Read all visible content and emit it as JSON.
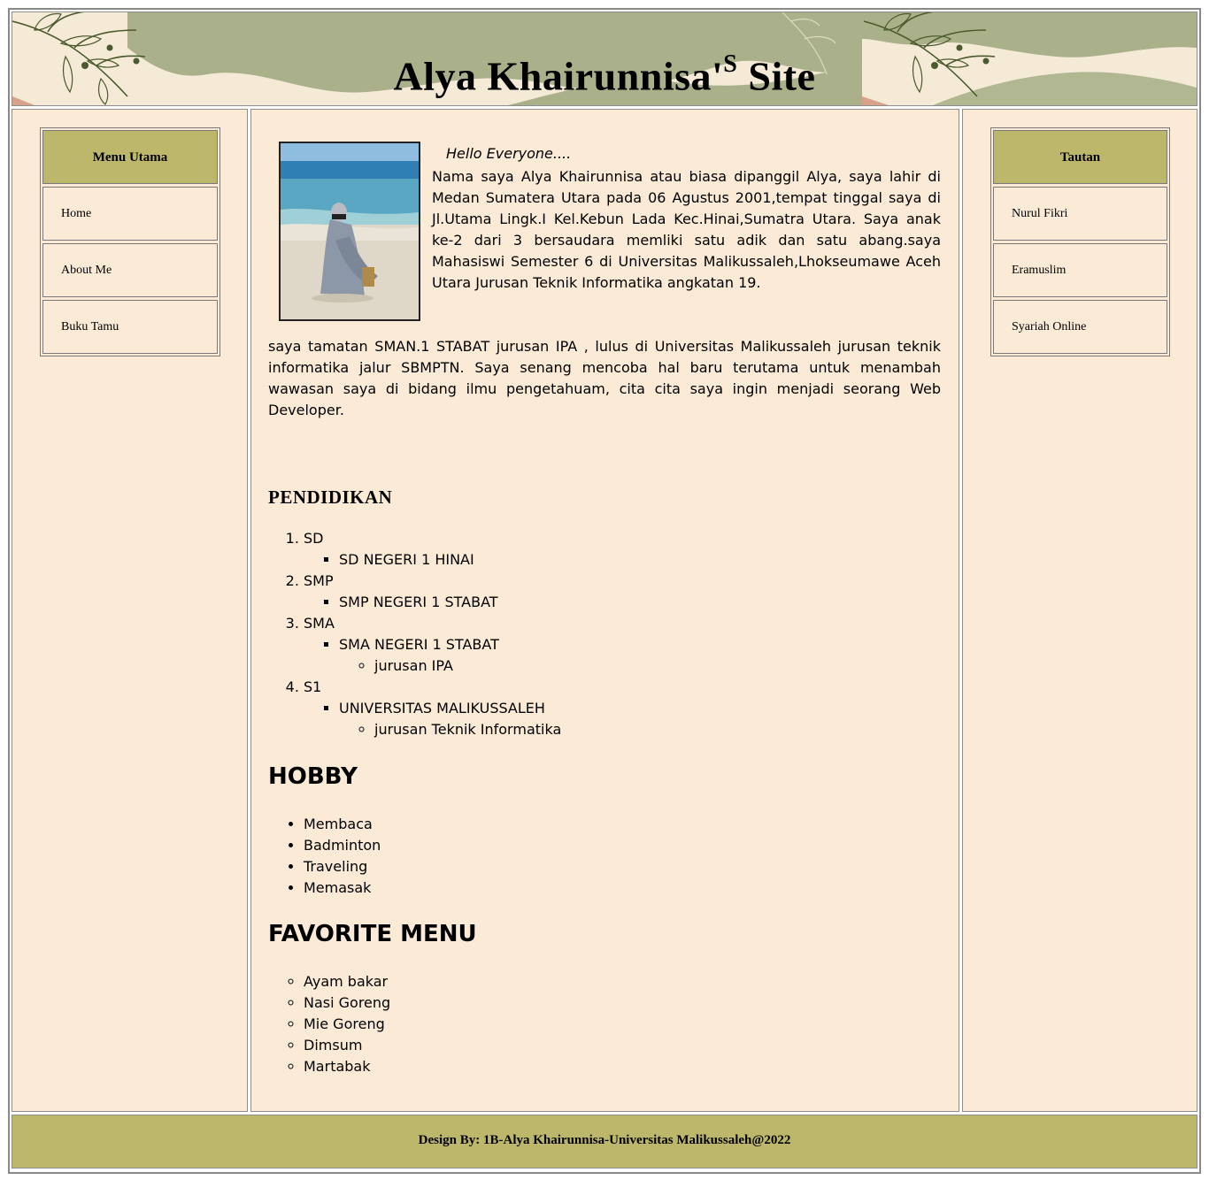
{
  "header": {
    "title_main": "Alya Khairunnisa'",
    "title_sup": "S",
    "title_end": " Site"
  },
  "left_menu": {
    "heading": "Menu Utama",
    "items": [
      "Home",
      "About Me",
      "Buku Tamu"
    ]
  },
  "right_menu": {
    "heading": "Tautan",
    "items": [
      "Nurul Fikri",
      "Eramuslim",
      "Syariah Online"
    ]
  },
  "main": {
    "greeting": "Hello Everyone....",
    "intro": "Nama saya Alya Khairunnisa atau biasa dipanggil Alya, saya lahir di Medan Sumatera Utara pada 06 Agustus 2001,tempat tinggal saya di Jl.Utama Lingk.I Kel.Kebun Lada Kec.Hinai,Sumatra Utara. Saya anak ke-2 dari 3 bersaudara memliki satu adik dan satu abang.saya Mahasiswi Semester 6 di Universitas Malikussaleh,Lhokseumawe Aceh Utara Jurusan Teknik Informatika angkatan 19.",
    "paragraph2": "saya tamatan SMAN.1 STABAT jurusan IPA , lulus di Universitas Malikussaleh jurusan teknik informatika jalur SBMPTN. Saya senang mencoba hal baru terutama untuk menambah wawasan saya di bidang ilmu pengetahuam, cita cita saya ingin menjadi seorang Web Developer.",
    "education_heading": "PENDIDIKAN",
    "education": [
      {
        "level": "SD",
        "school": "SD NEGERI 1 HINAI",
        "detail": ""
      },
      {
        "level": "SMP",
        "school": "SMP NEGERI 1 STABAT",
        "detail": ""
      },
      {
        "level": "SMA",
        "school": "SMA NEGERI 1 STABAT",
        "detail": "jurusan IPA"
      },
      {
        "level": "S1",
        "school": "UNIVERSITAS MALIKUSSALEH",
        "detail": "jurusan Teknik Informatika"
      }
    ],
    "hobby_heading": "HOBBY",
    "hobbies": [
      "Membaca",
      "Badminton",
      "Traveling",
      "Memasak"
    ],
    "favorite_heading": "FAVORITE MENU",
    "favorites": [
      "Ayam bakar",
      "Nasi Goreng",
      "Mie Goreng",
      "Dimsum",
      "Martabak"
    ]
  },
  "footer": {
    "text": "Design By: 1B-Alya Khairunnisa-Universitas Malikussaleh@2022"
  },
  "colors": {
    "accent": "#bdb76b",
    "background": "#faead6",
    "header_sage": "#aab18a"
  }
}
